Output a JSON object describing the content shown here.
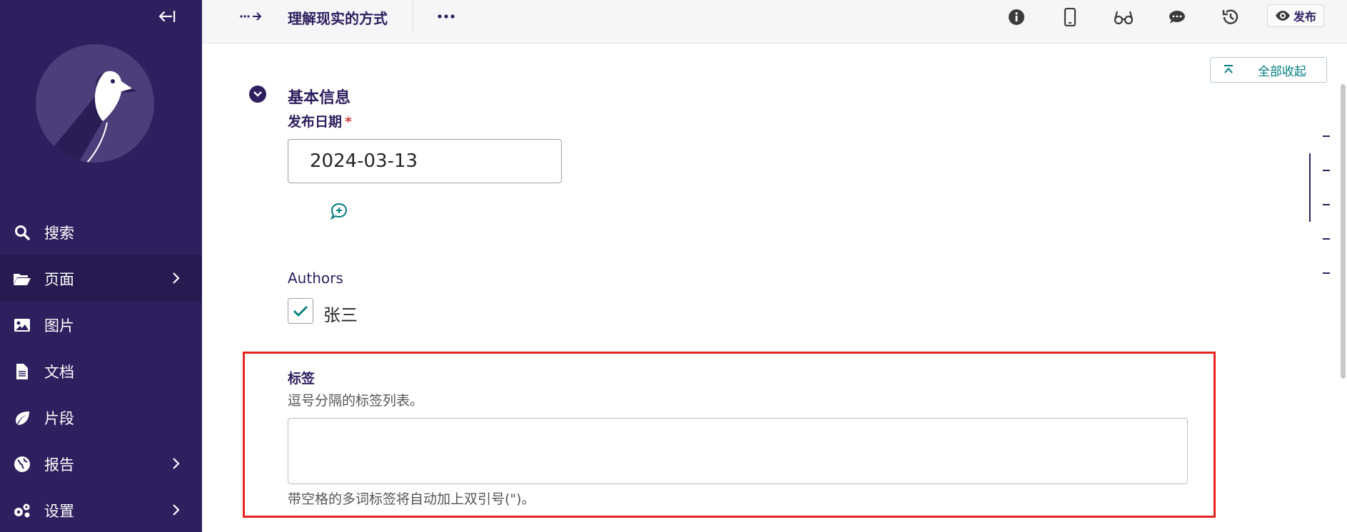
{
  "sidebar": {
    "items": [
      {
        "label": "搜索"
      },
      {
        "label": "页面"
      },
      {
        "label": "图片"
      },
      {
        "label": "文档"
      },
      {
        "label": "片段"
      },
      {
        "label": "报告"
      },
      {
        "label": "设置"
      }
    ]
  },
  "header": {
    "title": "理解现实的方式",
    "publish_label": "发布"
  },
  "toolbar": {
    "collapse_all_label": "全部收起"
  },
  "section": {
    "title": "基本信息"
  },
  "form": {
    "date_label": "发布日期",
    "date_required_mark": "*",
    "date_value": "2024-03-13",
    "authors_label": "Authors",
    "author_option": "张三",
    "author_checked": true,
    "tags_label": "标签",
    "tags_help": "逗号分隔的标签列表。",
    "tags_value": "",
    "tags_footnote": "带空格的多词标签将自动加上双引号(\")。"
  },
  "colors": {
    "sidebar_bg": "#2e1f5e",
    "accent_teal": "#007d7e",
    "highlight_red": "#e8231f"
  }
}
